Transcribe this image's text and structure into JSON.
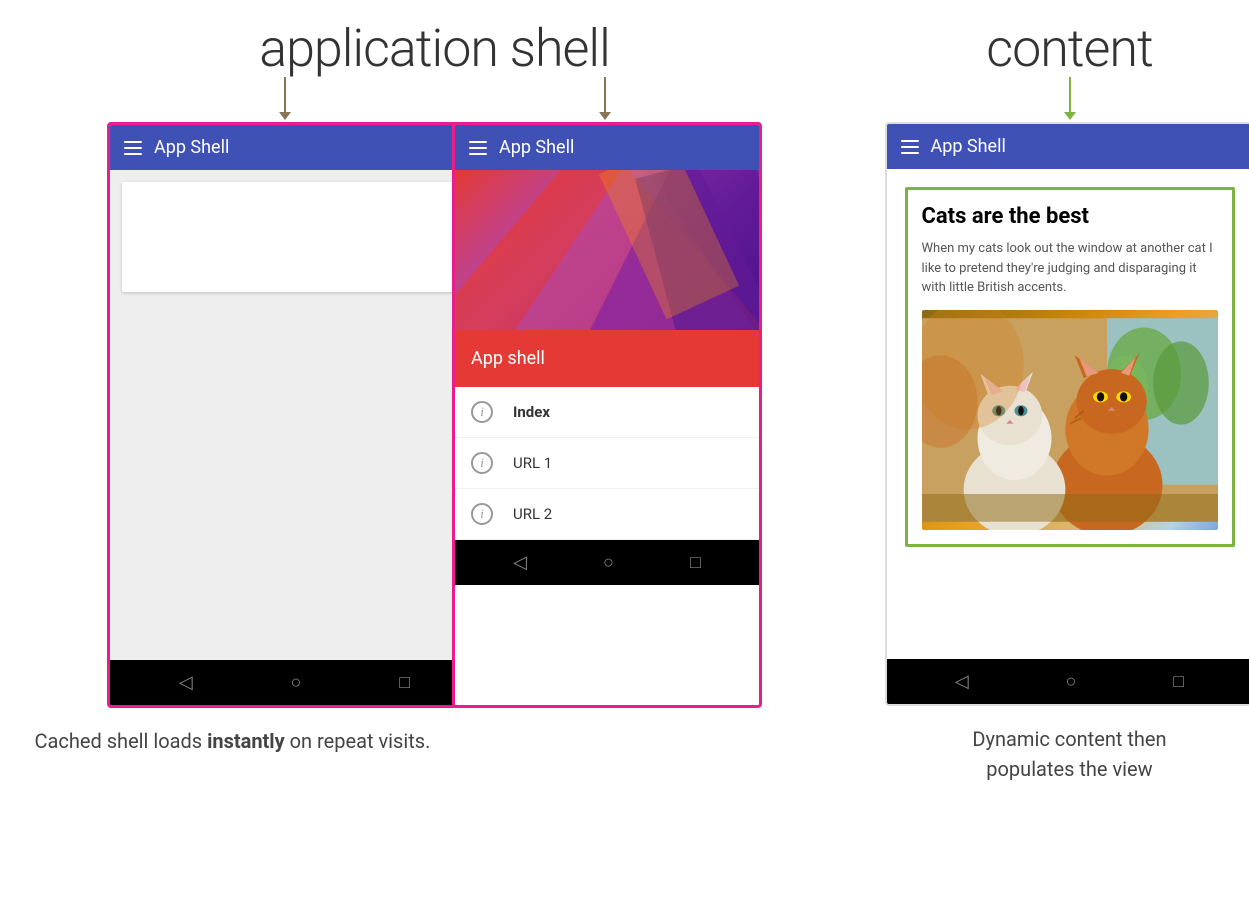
{
  "labels": {
    "app_shell_title": "application shell",
    "content_title": "content",
    "left_phone_app_shell": "App Shell",
    "center_phone_app_shell": "App Shell",
    "right_phone_app_shell": "App Shell",
    "app_shell_banner": "App shell",
    "cached_caption": "Cached shell loads ",
    "cached_bold": "instantly",
    "cached_caption_end": " on repeat visits.",
    "dynamic_caption_line1": "Dynamic content then",
    "dynamic_caption_line2": "populates the view",
    "cats_title": "Cats are the best",
    "cats_text": "When my cats look out the window at another cat I like to pretend they're judging and disparaging it with little British accents.",
    "menu_items": [
      {
        "label": "Index",
        "active": true
      },
      {
        "label": "URL 1",
        "active": false
      },
      {
        "label": "URL 2",
        "active": false
      }
    ],
    "nav_back": "◁",
    "nav_home": "○",
    "nav_recents": "□"
  },
  "colors": {
    "pink_border": "#e91e8c",
    "blue_header": "#3f51b5",
    "green_border": "#7cb342",
    "red_banner": "#e53935",
    "dark_gray_nav": "#000000",
    "arrow_brown": "#8B7355"
  }
}
